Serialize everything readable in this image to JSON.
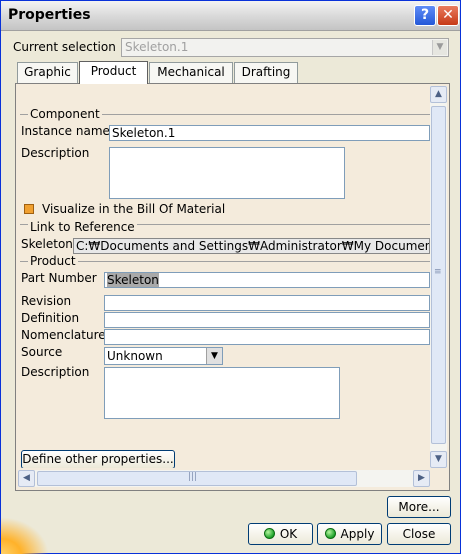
{
  "window": {
    "title": "Properties",
    "help_glyph": "?",
    "close_glyph": "✕"
  },
  "selection": {
    "label": "Current selection :",
    "value": "Skeleton.1"
  },
  "tabs": [
    {
      "label": "Graphic"
    },
    {
      "label": "Product"
    },
    {
      "label": "Mechanical"
    },
    {
      "label": "Drafting"
    }
  ],
  "component": {
    "group_label": "Component",
    "instance_name_label": "Instance name",
    "instance_name_value": "Skeleton.1",
    "description_label": "Description",
    "description_value": "",
    "visualize_label": "Visualize in the Bill Of Material"
  },
  "link": {
    "group_label": "Link to Reference",
    "skeleton_label": "Skeleton",
    "skeleton_path": "C:₩Documents and Settings₩Administrator₩My Documents₩"
  },
  "product": {
    "group_label": "Product",
    "part_number_label": "Part Number",
    "part_number_value": "Skeleton",
    "revision_label": "Revision",
    "revision_value": "",
    "definition_label": "Definition",
    "definition_value": "",
    "nomenclature_label": "Nomenclature",
    "nomenclature_value": "",
    "source_label": "Source",
    "source_value": "Unknown",
    "description_label": "Description",
    "description_value": ""
  },
  "buttons": {
    "define_other": "Define other properties...",
    "more": "More...",
    "ok": "OK",
    "apply": "Apply",
    "close": "Close"
  },
  "scroll_arrows": {
    "up": "▲",
    "down": "▼",
    "left": "◀",
    "right": "▶",
    "grip": "≡",
    "hgrip": "|||"
  },
  "colors": {
    "panel": "#f4ebdc",
    "title_close": "#c63a17",
    "title_help": "#2458d8",
    "ok_bulb": "#1ea22a"
  }
}
